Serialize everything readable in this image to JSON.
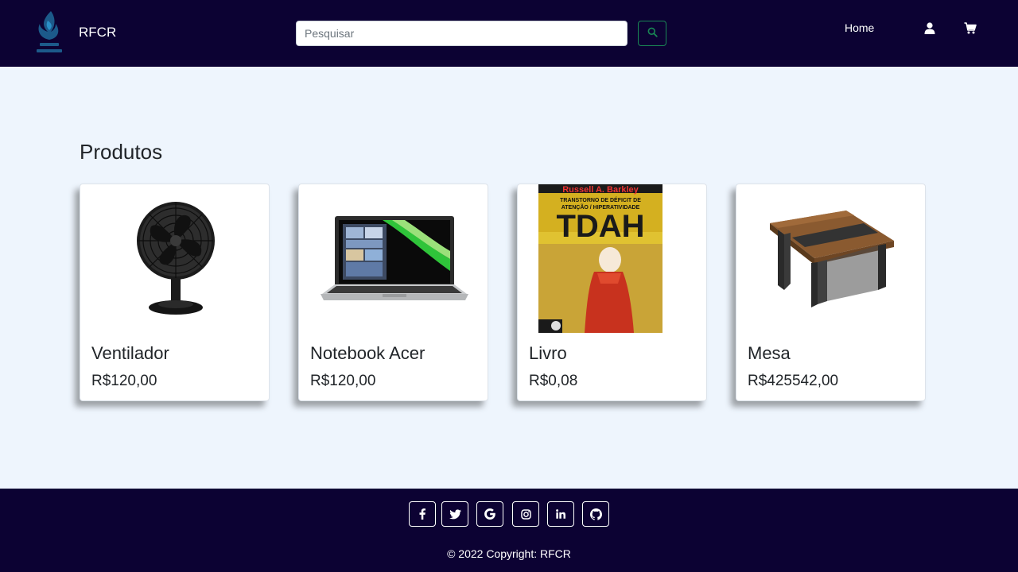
{
  "header": {
    "brand": "RFCR",
    "search_placeholder": "Pesquisar",
    "search_value": "",
    "nav": {
      "home": "Home"
    },
    "icons": {
      "search": "search-icon",
      "user": "user-icon",
      "cart": "cart-icon"
    },
    "colors": {
      "navbar": "#0c0233",
      "search_button_border": "#198754",
      "logo": "#1c5a8a"
    }
  },
  "main": {
    "title": "Produtos",
    "products": [
      {
        "name": "Ventilador",
        "price": "R$120,00",
        "image": "fan-image"
      },
      {
        "name": "Notebook Acer",
        "price": "R$120,00",
        "image": "laptop-image"
      },
      {
        "name": "Livro",
        "price": "R$0,08",
        "image": "book-cover-image",
        "cover": {
          "author": "Russell A. Barkley",
          "line1": "TRANSTORNO DE DÉFICIT DE",
          "line2": "ATENÇÃO / HIPERATIVIDADE",
          "big": "TDAH"
        }
      },
      {
        "name": "Mesa",
        "price": "R$425542,00",
        "image": "table-image"
      }
    ]
  },
  "footer": {
    "social": [
      {
        "name": "facebook-icon",
        "glyph": "f"
      },
      {
        "name": "twitter-icon",
        "glyph": ""
      },
      {
        "name": "google-icon",
        "glyph": "G"
      },
      {
        "name": "instagram-icon",
        "glyph": ""
      },
      {
        "name": "linkedin-icon",
        "glyph": "in"
      },
      {
        "name": "github-icon",
        "glyph": ""
      }
    ],
    "copyright": "© 2022 Copyright: RFCR"
  }
}
